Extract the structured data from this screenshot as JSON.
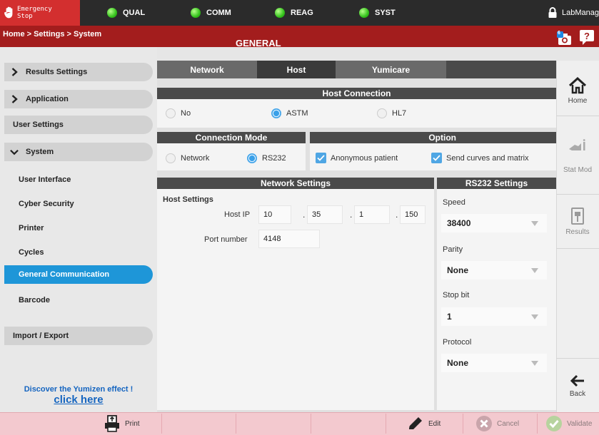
{
  "topbar": {
    "estop_line1": "Emergency",
    "estop_line2": "Stop",
    "status": [
      {
        "label": "QUAL",
        "color": "#34c21c"
      },
      {
        "label": "COMM",
        "color": "#34c21c"
      },
      {
        "label": "REAG",
        "color": "#34c21c"
      },
      {
        "label": "SYST",
        "color": "#34c21c"
      }
    ],
    "user": "LabManag"
  },
  "header": {
    "breadcrumb": "Home > Settings > System",
    "title": "GENERAL",
    "camera_badge": "6"
  },
  "sidebar": {
    "results_settings": "Results Settings",
    "application": "Application",
    "user_settings": "User Settings",
    "system": "System",
    "items": [
      "User Interface",
      "Cyber Security",
      "Printer",
      "Cycles",
      "General Communication",
      "Barcode"
    ],
    "active_item": "General Communication",
    "import_export": "Import / Export",
    "promo_line1": "Discover the Yumizen effect !",
    "promo_line2": "click here"
  },
  "tabs": [
    {
      "label": "Network",
      "active": false
    },
    {
      "label": "Host",
      "active": true
    },
    {
      "label": "Yumicare",
      "active": false
    }
  ],
  "host_connection": {
    "title": "Host Connection",
    "options": [
      "No",
      "ASTM",
      "HL7"
    ],
    "selected": "ASTM"
  },
  "connection_mode": {
    "title": "Connection Mode",
    "options": [
      "Network",
      "RS232"
    ],
    "selected": "RS232"
  },
  "option": {
    "title": "Option",
    "anonymous_patient": "Anonymous patient",
    "send_curves": "Send curves and matrix"
  },
  "network_settings": {
    "title": "Network Settings",
    "host_settings_label": "Host Settings",
    "host_ip_label": "Host IP",
    "ip": [
      "10",
      "35",
      "1",
      "150"
    ],
    "port_label": "Port number",
    "port": "4148"
  },
  "rs232": {
    "title": "RS232 Settings",
    "speed_label": "Speed",
    "speed": "38400",
    "parity_label": "Parity",
    "parity": "None",
    "stopbit_label": "Stop bit",
    "stopbit": "1",
    "protocol_label": "Protocol",
    "protocol": "None"
  },
  "rightnav": {
    "home": "Home",
    "stat_mode": "Stat Mod",
    "results": "Results",
    "back": "Back"
  },
  "bottombar": {
    "print": "Print",
    "edit": "Edit",
    "cancel": "Cancel",
    "validate": "Validate"
  },
  "colors": {
    "accent": "#1e96d8",
    "header_red": "#a31d1d",
    "estop_red": "#d32f2f",
    "status_green": "#34c21c",
    "bottom_pink": "#f3c9cf"
  }
}
